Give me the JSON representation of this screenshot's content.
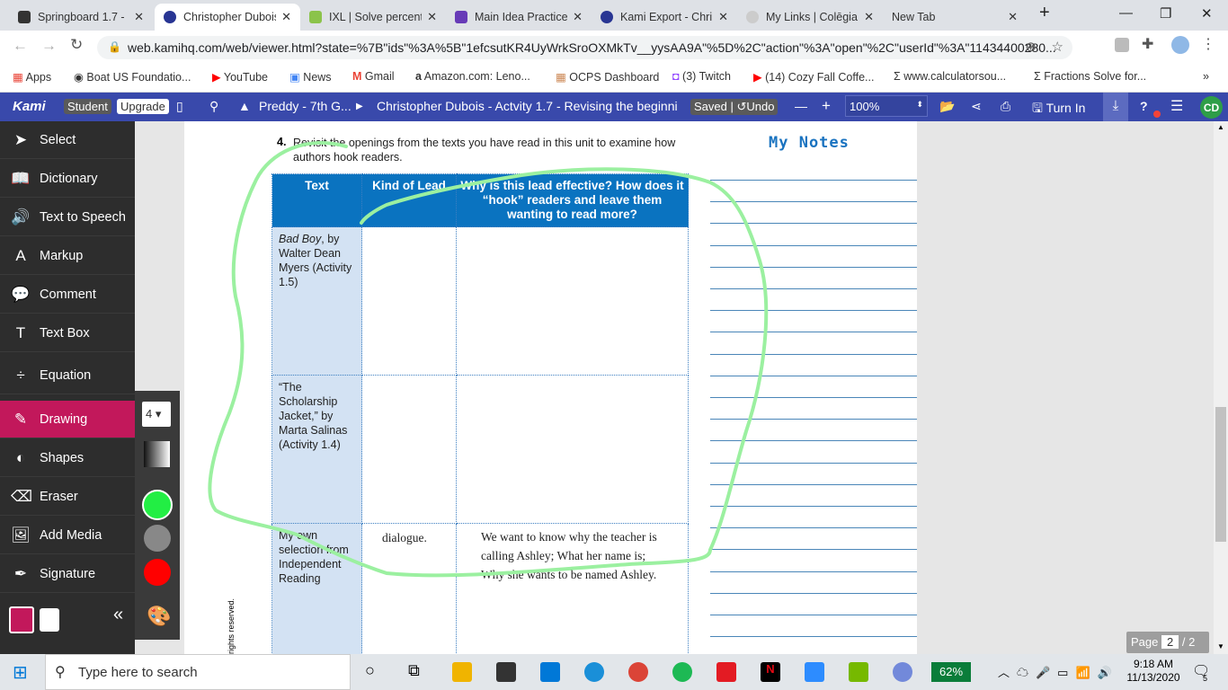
{
  "browser": {
    "tabs": [
      {
        "title": "Springboard 1.7 - ",
        "color": "#333333"
      },
      {
        "title": "Christopher Dubois",
        "color": "#283593",
        "active": true
      },
      {
        "title": "IXL | Solve percent",
        "color": "#8bc34a"
      },
      {
        "title": "Main Idea Practice",
        "color": "#673ab7"
      },
      {
        "title": "Kami Export - Chri",
        "color": "#283593"
      },
      {
        "title": "My Links | Colēgia",
        "color": "#cccccc"
      },
      {
        "title": "New Tab",
        "color": "#ffffff"
      }
    ],
    "url": "web.kamihq.com/web/viewer.html?state=%7B\"ids\"%3A%5B\"1efcsutKR4UyWrkSroOXMkTv__yysAA9A\"%5D%2C\"action\"%3A\"open\"%2C\"userId\"%3A\"11434400280...",
    "bookmarks": [
      "Apps",
      "Boat US Foundatio...",
      "YouTube",
      "News",
      "Gmail",
      "Amazon.com: Leno...",
      "OCPS Dashboard",
      "(3) Twitch",
      "(14) Cozy Fall Coffe...",
      "www.calculatorsou...",
      "Fractions Solve for..."
    ]
  },
  "kami": {
    "logo": "Kami",
    "student": "Student",
    "upgrade": "Upgrade",
    "folder": "Preddy - 7th G...",
    "doc_title": "Christopher Dubois - Actvity 1.7 - Revising the beginni",
    "saved": "Saved",
    "undo": "Undo",
    "zoom": "100%",
    "turn_in": "Turn In",
    "avatar": "CD"
  },
  "sidebar": [
    {
      "label": "Select",
      "icon": "cursor-icon"
    },
    {
      "label": "Dictionary",
      "icon": "book-icon"
    },
    {
      "label": "Text to Speech",
      "icon": "speaker-icon"
    },
    {
      "label": "Markup",
      "icon": "markup-icon"
    },
    {
      "label": "Comment",
      "icon": "comment-icon"
    },
    {
      "label": "Text Box",
      "icon": "text-icon"
    },
    {
      "label": "Equation",
      "icon": "divide-icon"
    },
    {
      "label": "Drawing",
      "icon": "pen-icon",
      "active": true
    },
    {
      "label": "Shapes",
      "icon": "shapes-icon"
    },
    {
      "label": "Eraser",
      "icon": "eraser-icon"
    },
    {
      "label": "Add Media",
      "icon": "media-icon"
    },
    {
      "label": "Signature",
      "icon": "signature-icon"
    }
  ],
  "drawing_tools": {
    "size": "4",
    "colors": [
      "#22ee44",
      "#888888",
      "#ff0000"
    ],
    "selected_color": "#22ee44"
  },
  "document": {
    "prompt_number": "4.",
    "prompt": "Revisit the openings from the texts you have read in this unit to examine how authors hook readers.",
    "notes_title": "My Notes",
    "headers": [
      "Text",
      "Kind of Lead",
      "Why is this lead effective? How does it “hook” readers and leave them wanting to read more?"
    ],
    "rows": [
      {
        "text_italic": "Bad Boy",
        "text": ", by Walter Dean Myers (Activity 1.5)",
        "lead": "",
        "why": ""
      },
      {
        "text_italic": "",
        "text": "“The Scholarship Jacket,” by Marta Salinas (Activity 1.4)",
        "lead": "",
        "why": ""
      },
      {
        "text_italic": "",
        "text": "My own selection from Independent Reading",
        "lead": "dialogue.",
        "why": "We want to know why the teacher is calling Ashley; What her name is; Why she wants to be named Ashley."
      }
    ],
    "copyright": "rights reserved."
  },
  "pager": {
    "label": "Page",
    "current": "2",
    "total": "/ 2"
  },
  "taskbar": {
    "search": "Type here to search",
    "battery": "62%",
    "time": "9:18 AM",
    "date": "11/13/2020",
    "notifications": "5"
  }
}
